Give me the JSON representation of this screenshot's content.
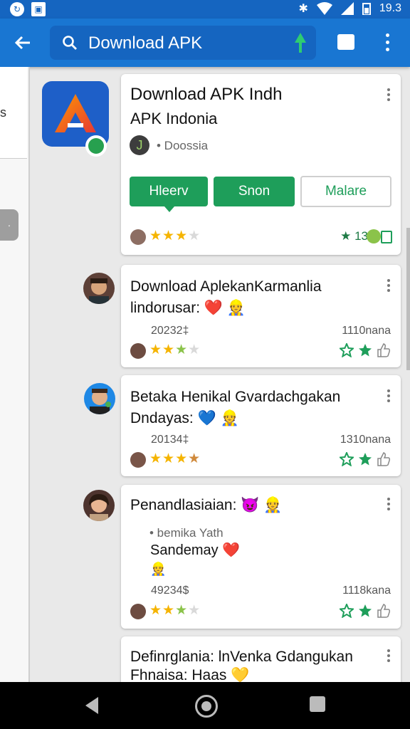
{
  "status_bar": {
    "time": "19.3"
  },
  "app_bar": {
    "search_text": "Download APK"
  },
  "left_panel": {
    "card_text": "s"
  },
  "cards": [
    {
      "title_line1": "Download APK Indh",
      "title_line2": "APK Indonia",
      "developer_initial": "J",
      "developer": "• Doossia",
      "buttons": [
        "Hleerv",
        "Snon",
        "Malare"
      ],
      "rating_count": "★ 13"
    },
    {
      "title_line1": "Download AplekanKarmanlia",
      "title_line2": "lindorusar: ❤️ 👷",
      "date": "20232‡",
      "size": "1110nana"
    },
    {
      "title_line1": "Betaka Henikal Gvardachgakan",
      "title_line2": "Dndayas: 💙 👷",
      "date": "20134‡",
      "size": "1310nana"
    },
    {
      "title_line1": "Penandlasiaian: 😈 👷",
      "bullet": "• bemika Yath",
      "line3": "Sandemay ❤️",
      "line4": "👷",
      "date": "49234$",
      "size": "1118kana"
    },
    {
      "title_line1": "Definrglania: lnVenka Gdangukan",
      "title_line2": "Fhnaisa: Haas 💛"
    }
  ],
  "colors": {
    "primary": "#1976d2",
    "green": "#1e9e5a",
    "star": "#f5b400"
  }
}
